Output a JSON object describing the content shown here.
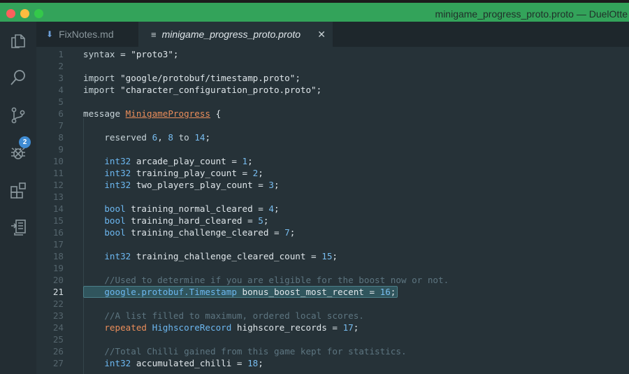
{
  "window": {
    "title": "minigame_progress_proto.proto — DuelOtte"
  },
  "activity_bar": {
    "items": [
      "explorer-icon",
      "search-icon",
      "source-control-icon",
      "debug-icon",
      "extensions-icon",
      "remote-icon"
    ],
    "scm_badge": "2"
  },
  "tabs": [
    {
      "label": "FixNotes.md",
      "icon": "markdown-icon",
      "active": false
    },
    {
      "label": "minigame_progress_proto.proto",
      "icon": "proto-file-icon",
      "active": true,
      "close": "✕"
    }
  ],
  "editor": {
    "current_line": 21,
    "lines": [
      {
        "n": "1",
        "html": "<span class='kw'>syntax</span> = <span class='strq'>\"proto3\"</span>;"
      },
      {
        "n": "2",
        "html": ""
      },
      {
        "n": "3",
        "html": "<span class='kw'>import</span> <span class='strq'>\"google/protobuf/timestamp.proto\"</span>;"
      },
      {
        "n": "4",
        "html": "<span class='kw'>import</span> <span class='strq'>\"character_configuration_proto.proto\"</span>;"
      },
      {
        "n": "5",
        "html": ""
      },
      {
        "n": "6",
        "html": "<span class='kw'>message</span> <span class='msgname'>MinigameProgress</span> {"
      },
      {
        "n": "7",
        "html": ""
      },
      {
        "n": "8",
        "html": "    <span class='kw'>reserved</span> <span class='num'>6</span>, <span class='num'>8</span> <span class='kw'>to</span> <span class='num'>14</span>;"
      },
      {
        "n": "9",
        "html": ""
      },
      {
        "n": "10",
        "html": "    <span class='type'>int32</span> arcade_play_count = <span class='num'>1</span>;"
      },
      {
        "n": "11",
        "html": "    <span class='type'>int32</span> training_play_count = <span class='num'>2</span>;"
      },
      {
        "n": "12",
        "html": "    <span class='type'>int32</span> two_players_play_count = <span class='num'>3</span>;"
      },
      {
        "n": "13",
        "html": ""
      },
      {
        "n": "14",
        "html": "    <span class='type'>bool</span> training_normal_cleared = <span class='num'>4</span>;"
      },
      {
        "n": "15",
        "html": "    <span class='type'>bool</span> training_hard_cleared = <span class='num'>5</span>;"
      },
      {
        "n": "16",
        "html": "    <span class='type'>bool</span> training_challenge_cleared = <span class='num'>7</span>;"
      },
      {
        "n": "17",
        "html": ""
      },
      {
        "n": "18",
        "html": "    <span class='type'>int32</span> training_challenge_cleared_count = <span class='num'>15</span>;"
      },
      {
        "n": "19",
        "html": ""
      },
      {
        "n": "20",
        "html": "    <span class='cmt'>//Used to determine if you are eligible for the boost now or not.</span>"
      },
      {
        "n": "21",
        "html": "    <span class='gtype'>google.protobuf.Timestamp</span> bonus_boost_most_recent = <span class='num'>16</span>;"
      },
      {
        "n": "22",
        "html": ""
      },
      {
        "n": "23",
        "html": "    <span class='cmt'>//A list filled to maximum, ordered local scores.</span>"
      },
      {
        "n": "24",
        "html": "    <span class='pink'>repeated</span> <span class='type'>HighscoreRecord</span> highscore_records = <span class='num'>17</span>;"
      },
      {
        "n": "25",
        "html": ""
      },
      {
        "n": "26",
        "html": "    <span class='cmt'>//Total Chilli gained from this game kept for statistics.</span>"
      },
      {
        "n": "27",
        "html": "    <span class='type'>int32</span> accumulated_chilli = <span class='num'>18</span>;"
      }
    ]
  }
}
